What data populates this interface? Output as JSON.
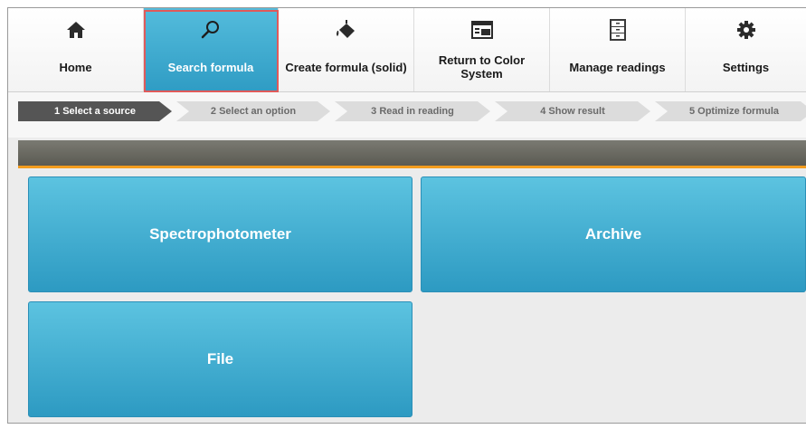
{
  "toolbar": {
    "items": [
      {
        "label": "Home",
        "icon": "home-icon"
      },
      {
        "label": "Search formula",
        "icon": "search-icon",
        "active": true
      },
      {
        "label": "Create formula (solid)",
        "icon": "paint-bucket-icon"
      },
      {
        "label": "Return to Color System",
        "icon": "window-icon"
      },
      {
        "label": "Manage readings",
        "icon": "file-cabinet-icon"
      },
      {
        "label": "Settings",
        "icon": "gear-icon"
      }
    ]
  },
  "steps": [
    {
      "label": "1 Select a source",
      "active": true
    },
    {
      "label": "2 Select an option"
    },
    {
      "label": "3 Read in reading"
    },
    {
      "label": "4 Show result"
    },
    {
      "label": "5 Optimize formula"
    }
  ],
  "sources": {
    "spectrophotometer": "Spectrophotometer",
    "archive": "Archive",
    "file": "File"
  },
  "colors": {
    "accent_blue": "#3aa9cf",
    "highlight_red": "#e05a5a",
    "header_orange": "#f39c1e"
  }
}
